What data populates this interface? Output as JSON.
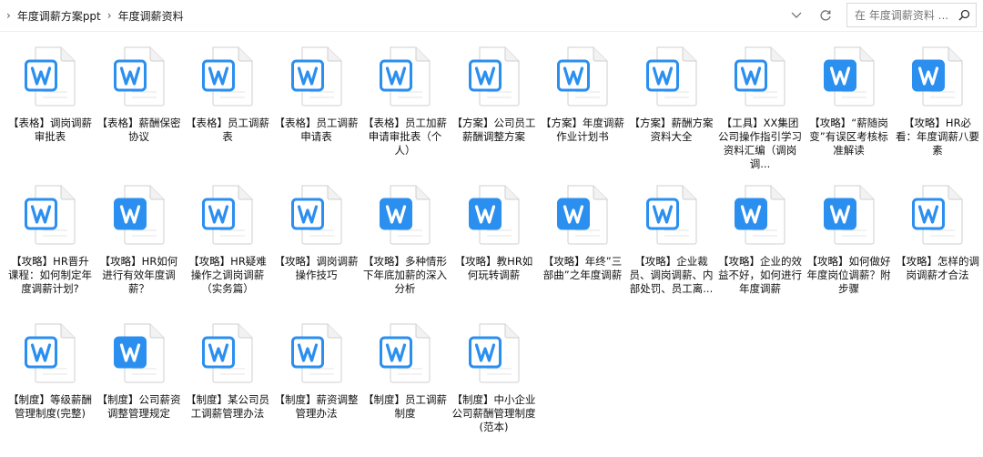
{
  "breadcrumb": {
    "items": [
      "年度调薪方案ppt",
      "年度调薪资料"
    ]
  },
  "search": {
    "placeholder": "在 年度调薪资料 ..."
  },
  "icons": {
    "dropdown": "chevron-down-icon",
    "refresh": "refresh-icon",
    "search": "magnifier-icon",
    "file": "word-document-icon"
  },
  "colors": {
    "word_blue": "#2b8ff0",
    "word_blue_dark": "#1f73d6"
  },
  "files": [
    {
      "label": "【表格】调岗调薪审批表",
      "filled": false
    },
    {
      "label": "【表格】薪酬保密协议",
      "filled": false
    },
    {
      "label": "【表格】员工调薪表",
      "filled": false
    },
    {
      "label": "【表格】员工调薪申请表",
      "filled": false
    },
    {
      "label": "【表格】员工加薪申请审批表（个人）",
      "filled": false
    },
    {
      "label": "【方案】公司员工薪酬调整方案",
      "filled": false
    },
    {
      "label": "【方案】年度调薪作业计划书",
      "filled": false
    },
    {
      "label": "【方案】薪酬方案资料大全",
      "filled": false
    },
    {
      "label": "【工具】XX集团公司操作指引学习资料汇编（调岗调...",
      "filled": false
    },
    {
      "label": "【攻略】“薪随岗变”有误区考核标准解读",
      "filled": true
    },
    {
      "label": "【攻略】HR必看：年度调薪八要素",
      "filled": true
    },
    {
      "label": "【攻略】HR晋升课程：如何制定年度调薪计划?",
      "filled": false
    },
    {
      "label": "【攻略】HR如何进行有效年度调薪？",
      "filled": true
    },
    {
      "label": "【攻略】HR疑难操作之调岗调薪（实务篇）",
      "filled": false
    },
    {
      "label": "【攻略】调岗调薪操作技巧",
      "filled": false
    },
    {
      "label": "【攻略】多种情形下年底加薪的深入分析",
      "filled": true
    },
    {
      "label": "【攻略】教HR如何玩转调薪",
      "filled": true
    },
    {
      "label": "【攻略】年终”三部曲”之年度调薪",
      "filled": true
    },
    {
      "label": "【攻略】企业裁员、调岗调薪、内部处罚、员工离...",
      "filled": false
    },
    {
      "label": "【攻略】企业的效益不好，如何进行年度调薪",
      "filled": true
    },
    {
      "label": "【攻略】如何做好年度岗位调薪？附步骤",
      "filled": true
    },
    {
      "label": "【攻略】怎样的调岗调薪才合法",
      "filled": false
    },
    {
      "label": "【制度】等级薪酬管理制度(完整)",
      "filled": false
    },
    {
      "label": "【制度】公司薪资调整管理规定",
      "filled": true
    },
    {
      "label": "【制度】某公司员工调薪管理办法",
      "filled": false
    },
    {
      "label": "【制度】薪资调整管理办法",
      "filled": false
    },
    {
      "label": "【制度】员工调薪制度",
      "filled": false
    },
    {
      "label": "【制度】中小企业公司薪酬管理制度(范本)",
      "filled": false
    }
  ]
}
